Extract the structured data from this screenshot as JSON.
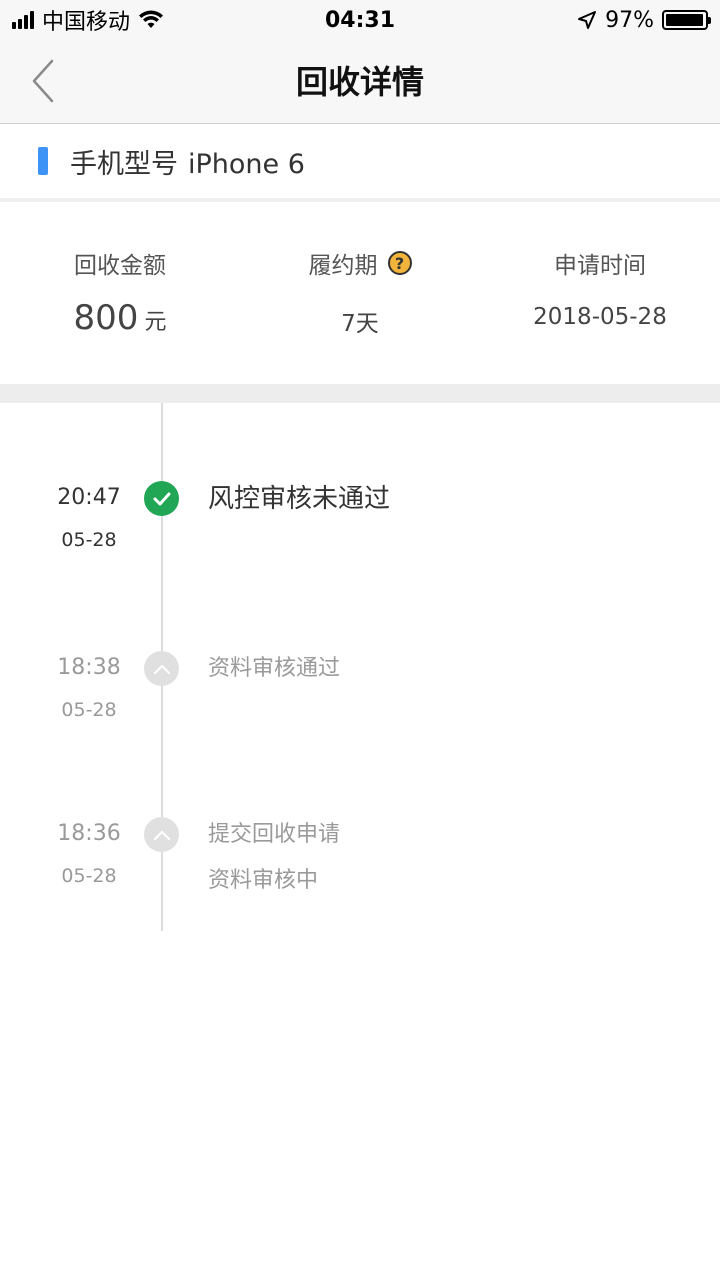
{
  "status_bar": {
    "carrier": "中国移动",
    "time": "04:31",
    "battery": "97%",
    "battery_level": 0.97
  },
  "nav": {
    "title": "回收详情"
  },
  "model": {
    "label": "手机型号",
    "value": "iPhone 6"
  },
  "summary": {
    "amount_label": "回收金额",
    "amount_value": "800",
    "amount_unit": "元",
    "period_label": "履约期",
    "period_help_glyph": "?",
    "period_value": "7天",
    "apply_time_label": "申请时间",
    "apply_time_value": "2018-05-28"
  },
  "timeline": [
    {
      "time": "20:47",
      "date": "05-28",
      "lines": [
        "风控审核未通过"
      ],
      "status": "done"
    },
    {
      "time": "18:38",
      "date": "05-28",
      "lines": [
        "资料审核通过"
      ],
      "status": "past"
    },
    {
      "time": "18:36",
      "date": "05-28",
      "lines": [
        "提交回收申请",
        "资料审核中"
      ],
      "status": "past"
    }
  ],
  "colors": {
    "accent_blue": "#3d94f6",
    "amount_orange": "#f0a54a",
    "success_green": "#20a655",
    "help_yellow": "#f2b43a"
  }
}
